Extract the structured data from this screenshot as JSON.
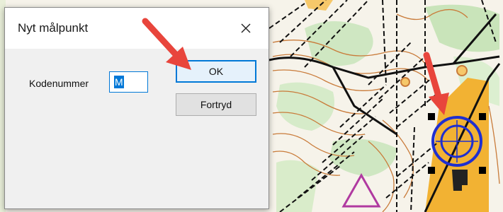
{
  "dialog": {
    "title": "Nyt målpunkt",
    "close_icon": "close-icon",
    "field_label": "Kodenummer",
    "field_value": "M",
    "ok_label": "OK",
    "cancel_label": "Fortryd"
  },
  "colors": {
    "accent": "#0078d7",
    "arrow": "#e8453c",
    "map_contour": "#c97b3a",
    "map_road": "#111111",
    "map_green": "#9ccf8a",
    "map_yellow": "#f2b233",
    "map_control_circle": "#1f2fd0",
    "map_finish_triangle": "#b03aa0"
  }
}
